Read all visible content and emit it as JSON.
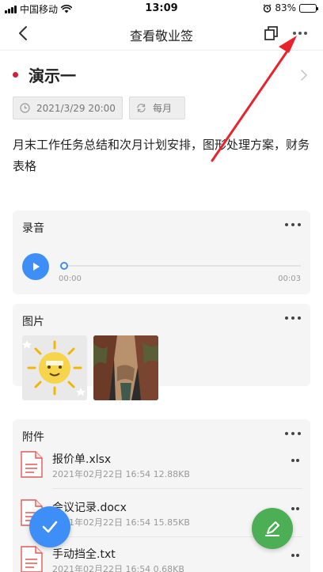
{
  "status_bar": {
    "carrier": "中国移动",
    "time": "13:09",
    "battery": "83%",
    "battery_level": 0.83
  },
  "navbar": {
    "title": "查看敬业签",
    "back_icon": "chevron-left-icon",
    "copy_icon": "copy-icon",
    "more_icon": "more-dots-icon"
  },
  "note": {
    "title": "演示一",
    "date": "2021/3/29 20:00",
    "repeat": "每月",
    "content": "月末工作任务总结和次月计划安排，图形处理方案，财务表格"
  },
  "audio": {
    "label": "录音",
    "current_time": "00:00",
    "duration": "00:03",
    "progress": 0
  },
  "images": {
    "label": "图片"
  },
  "attachments": {
    "label": "附件",
    "files": [
      {
        "name": "报价单.xlsx",
        "meta": "2021年02月22日 16:54  12.88KB"
      },
      {
        "name": "会议记录.docx",
        "meta": "2021年02月22日 16:54  15.85KB"
      },
      {
        "name": "手动挡全.txt",
        "meta": "2021年02月22日 16:54  0.68KB"
      }
    ]
  },
  "colors": {
    "accent_blue": "#3e8ef7",
    "accent_green": "#4cae55",
    "annotation_red": "#e8232b",
    "title_dot": "#d0203b"
  }
}
